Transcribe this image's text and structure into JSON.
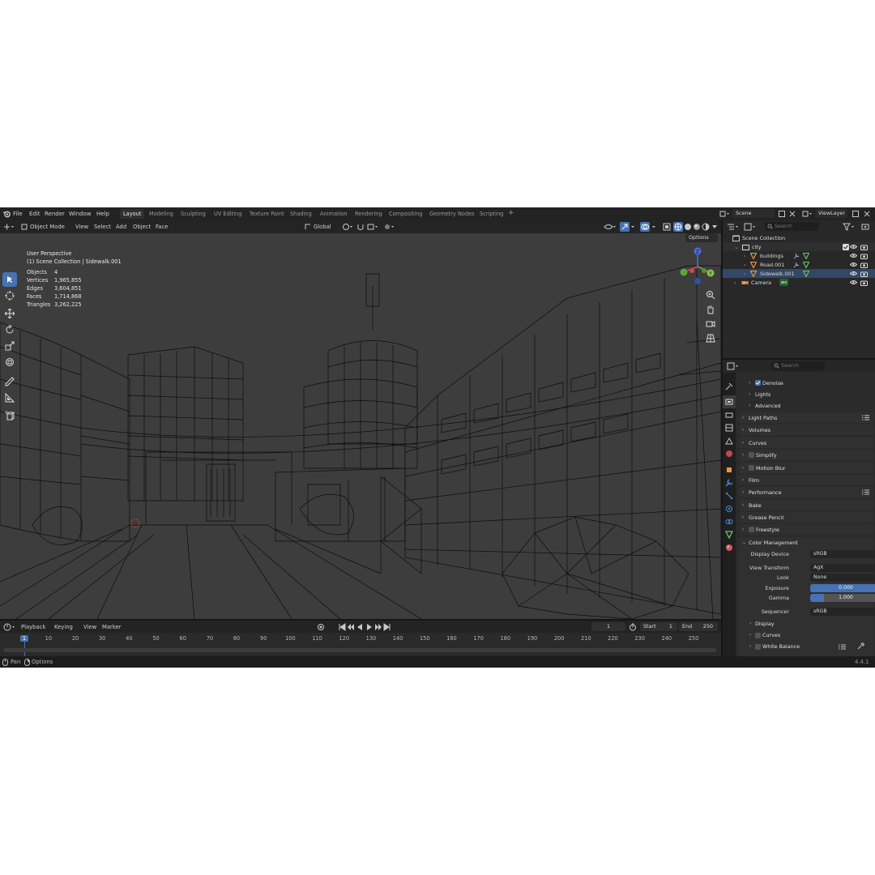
{
  "menu": {
    "file": "File",
    "edit": "Edit",
    "render": "Render",
    "window": "Window",
    "help": "Help"
  },
  "workspaces": [
    "Layout",
    "Modeling",
    "Sculpting",
    "UV Editing",
    "Texture Paint",
    "Shading",
    "Animation",
    "Rendering",
    "Compositing",
    "Geometry Nodes",
    "Scripting"
  ],
  "add_workspace": "+",
  "scene": {
    "name": "Scene",
    "view_layer": "ViewLayer"
  },
  "viewport_header": {
    "mode": "Object Mode",
    "view": "View",
    "select": "Select",
    "add": "Add",
    "object": "Object",
    "face": "Face",
    "orientation": "Global",
    "options": "Options"
  },
  "overlay": {
    "perspective": "User Perspective",
    "collection_path": "(1) Scene Collection | Sidewalk.001",
    "stats": [
      {
        "label": "Objects",
        "value": "4"
      },
      {
        "label": "Vertices",
        "value": "1,965,855"
      },
      {
        "label": "Edges",
        "value": "3,604,851"
      },
      {
        "label": "Faces",
        "value": "1,714,868"
      },
      {
        "label": "Triangles",
        "value": "3,262,225"
      }
    ]
  },
  "gizmo": {
    "z": "Z",
    "y": "Y"
  },
  "outliner": {
    "search_placeholder": "Search",
    "root": "Scene Collection",
    "items": [
      {
        "name": "city"
      },
      {
        "name": "buildings"
      },
      {
        "name": "Road.001"
      },
      {
        "name": "Sidewalk.001"
      },
      {
        "name": "Camera"
      }
    ]
  },
  "properties": {
    "search_placeholder": "Search",
    "panels": [
      {
        "label": "Denoise"
      },
      {
        "label": "Lights"
      },
      {
        "label": "Advanced"
      },
      {
        "label": "Light Paths"
      },
      {
        "label": "Volumes"
      },
      {
        "label": "Curves"
      },
      {
        "label": "Simplify"
      },
      {
        "label": "Motion Blur"
      },
      {
        "label": "Film"
      },
      {
        "label": "Performance"
      },
      {
        "label": "Bake"
      },
      {
        "label": "Grease Pencil"
      },
      {
        "label": "Freestyle"
      },
      {
        "label": "Color Management"
      }
    ],
    "color_management": {
      "display_device_label": "Display Device",
      "display_device": "sRGB",
      "view_transform_label": "View Transform",
      "view_transform": "AgX",
      "look_label": "Look",
      "look": "None",
      "exposure_label": "Exposure",
      "exposure": "0.000",
      "gamma_label": "Gamma",
      "gamma": "1.000",
      "sequencer_label": "Sequencer",
      "sequencer": "sRGB"
    },
    "sub_panels": [
      "Display",
      "Curves",
      "White Balance"
    ]
  },
  "timeline": {
    "playback": "Playback",
    "keying": "Keying",
    "view": "View",
    "marker": "Marker",
    "current_frame": "1",
    "start_label": "Start",
    "start": "1",
    "end_label": "End",
    "end": "250",
    "ticks": [
      "1",
      "10",
      "20",
      "30",
      "40",
      "50",
      "60",
      "70",
      "80",
      "90",
      "100",
      "110",
      "120",
      "130",
      "140",
      "150",
      "160",
      "170",
      "180",
      "190",
      "200",
      "210",
      "220",
      "230",
      "240",
      "250"
    ]
  },
  "statusbar": {
    "pan": "Pan",
    "options": "Options",
    "version": "4.4.1"
  },
  "colors": {
    "accent": "#4772b3",
    "viewport_bg": "#3d3d3d",
    "panel_bg": "#2b2b2b",
    "object_orange": "#e69845",
    "mesh_green": "#6cc36c"
  }
}
